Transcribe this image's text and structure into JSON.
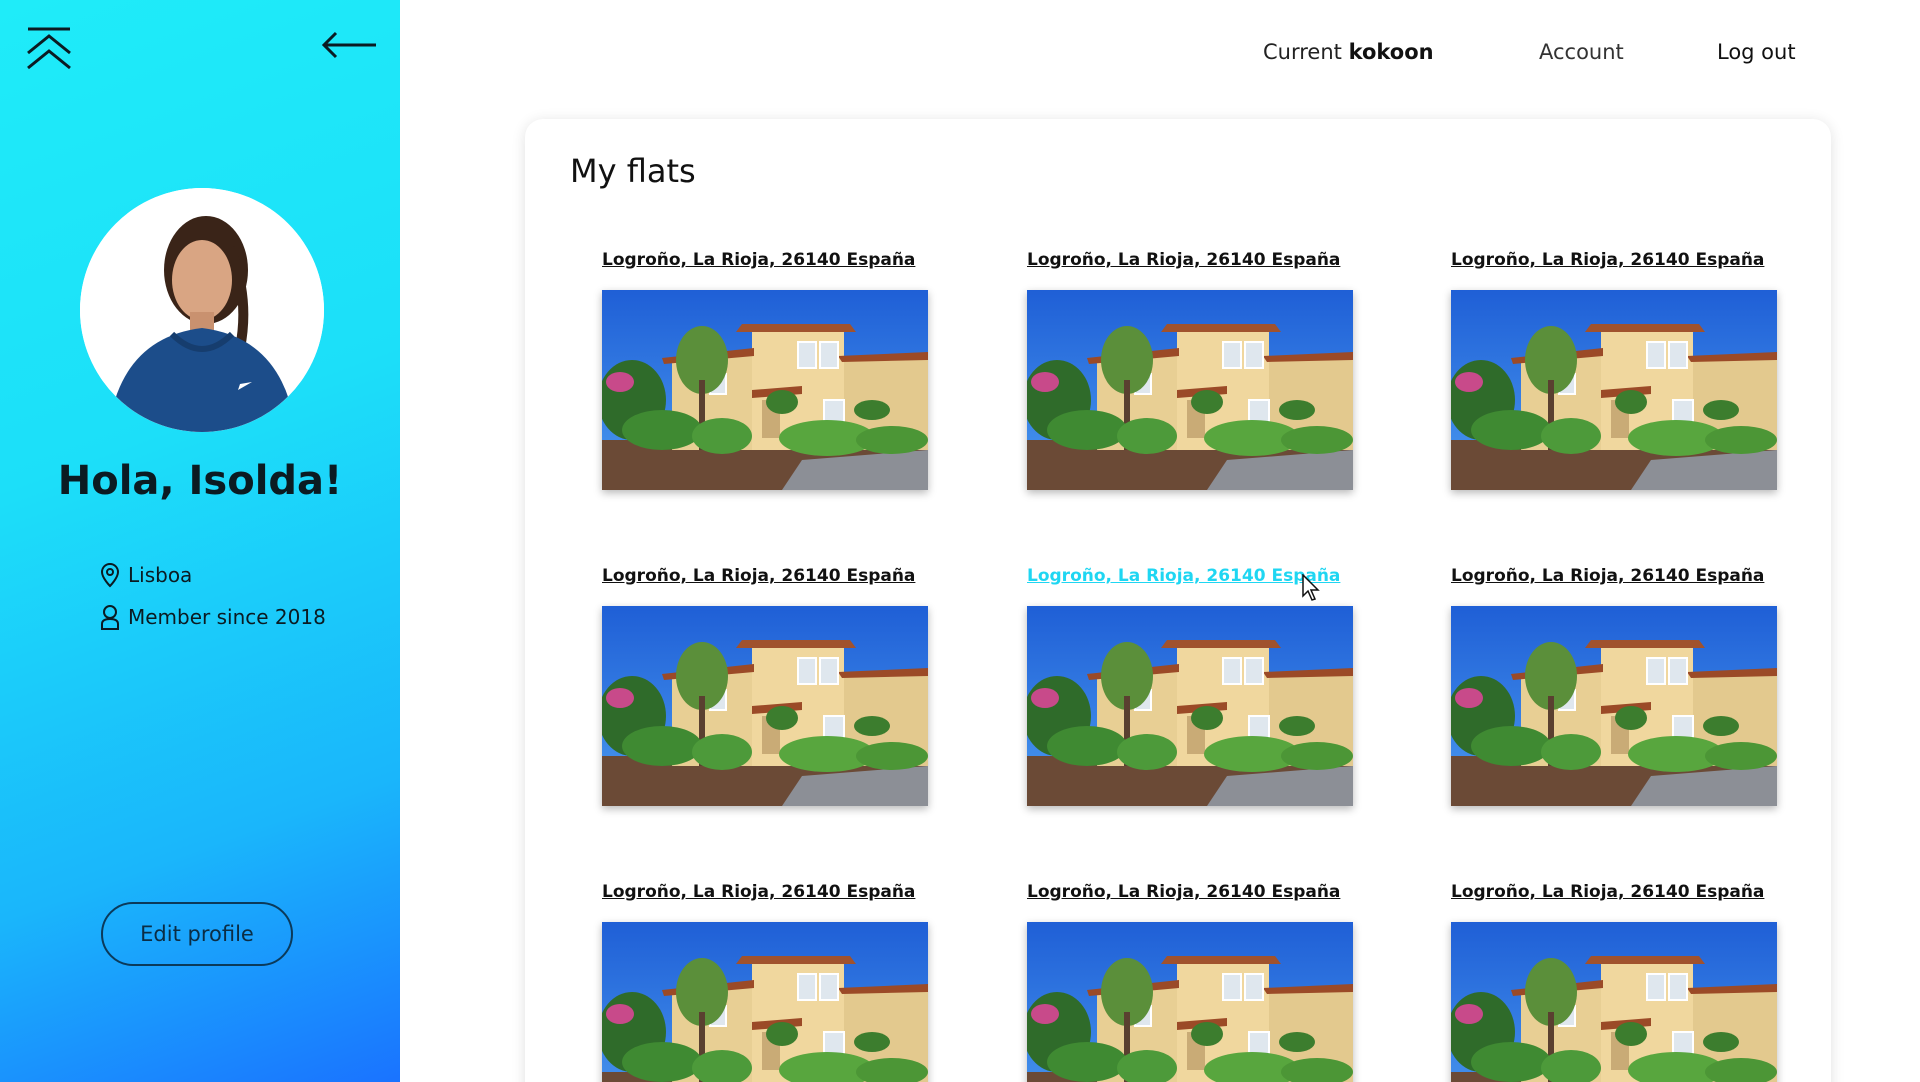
{
  "sidebar": {
    "greeting": "Hola, Isolda!",
    "location": "Lisboa",
    "member_since": "Member since 2018",
    "edit_button": "Edit profile",
    "background_top": "#1fecf9",
    "background_bottom": "#1a73ff"
  },
  "nav": {
    "current_prefix": "Current",
    "current_brand": "kokoon",
    "account": "Account",
    "logout": "Log out"
  },
  "main": {
    "title": "My flats",
    "hover_link_color": "#1fd6f2",
    "flats": [
      {
        "address": "Logroño, La Rioja, 26140 España"
      },
      {
        "address": "Logroño, La Rioja, 26140 España"
      },
      {
        "address": "Logroño, La Rioja, 26140 España"
      },
      {
        "address": "Logroño, La Rioja, 26140 España"
      },
      {
        "address": "Logroño, La Rioja, 26140 España"
      },
      {
        "address": "Logroño, La Rioja, 26140 España"
      },
      {
        "address": "Logroño, La Rioja, 26140 España"
      },
      {
        "address": "Logroño, La Rioja, 26140 España"
      },
      {
        "address": "Logroño, La Rioja, 26140 España"
      }
    ]
  }
}
